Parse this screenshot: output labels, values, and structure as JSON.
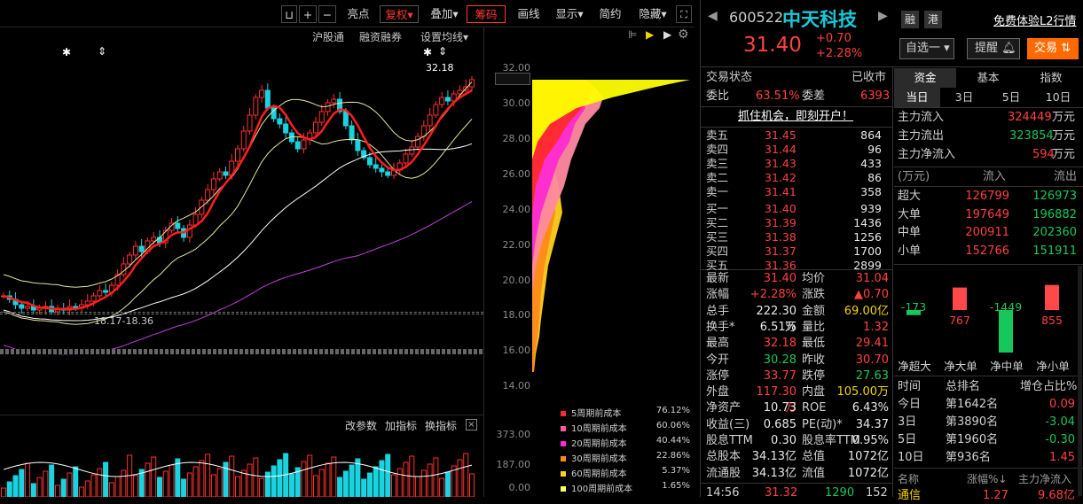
{
  "toolbar": {
    "items": [
      "亮点",
      "复权",
      "叠加",
      "筹码",
      "画线",
      "显示",
      "简约",
      "隐藏"
    ],
    "fq_label": "复权",
    "overlay_label": "叠加",
    "chip_label": "筹码"
  },
  "subbar": {
    "hgt": "沪股通",
    "rzrq": "融资融券",
    "ma": "设置均线"
  },
  "chart": {
    "high_label": "32.18",
    "range_label": "18.17-18.36",
    "price_ticks": [
      "32.00",
      "31.08",
      "30.00",
      "28.00",
      "26.00",
      "24.00",
      "22.00",
      "20.00",
      "18.00",
      "16.00",
      "14.00"
    ],
    "vol_ticks": [
      "373.00",
      "187.00",
      "0.00"
    ],
    "indicators": {
      "params": "改参数",
      "add": "加指标",
      "swap": "换指标"
    }
  },
  "chip_legend": [
    {
      "label": "5周期前成本",
      "pct": "76.12%",
      "color": "#ff2a2a"
    },
    {
      "label": "10周期前成本",
      "pct": "60.06%",
      "color": "#ff5aa0"
    },
    {
      "label": "20周期前成本",
      "pct": "40.44%",
      "color": "#ff2ad0"
    },
    {
      "label": "30周期前成本",
      "pct": "22.86%",
      "color": "#ff8a1a"
    },
    {
      "label": "60周期前成本",
      "pct": "5.37%",
      "color": "#ffd21a"
    },
    {
      "label": "100周期前成本",
      "pct": "1.65%",
      "color": "#ffff66"
    }
  ],
  "stock": {
    "code": "600522",
    "name": "中天科技",
    "price": "31.40",
    "change": "+0.70",
    "change_pct": "+2.28%",
    "tag_rong": "融",
    "tag_gang": "港",
    "l2": "免费体验L2行情",
    "self_select": "自选一",
    "alert": "提醒",
    "trade": "交易",
    "status_label": "交易状态",
    "status": "已收市",
    "weibi_label": "委比",
    "weibi": "63.51%",
    "weicha_label": "委差",
    "weicha": "6393",
    "promo": "抓住机会，即刻开户！"
  },
  "orderbook": {
    "sell": [
      [
        "卖五",
        "31.45",
        "864"
      ],
      [
        "卖四",
        "31.44",
        "96"
      ],
      [
        "卖三",
        "31.43",
        "433"
      ],
      [
        "卖二",
        "31.42",
        "86"
      ],
      [
        "卖一",
        "31.41",
        "358"
      ]
    ],
    "buy": [
      [
        "买一",
        "31.40",
        "939"
      ],
      [
        "买二",
        "31.39",
        "1436"
      ],
      [
        "买三",
        "31.38",
        "1256"
      ],
      [
        "买四",
        "31.37",
        "1700"
      ],
      [
        "买五",
        "31.36",
        "2899"
      ]
    ]
  },
  "quote": [
    [
      "最新",
      "31.40",
      "均价",
      "31.04"
    ],
    [
      "涨幅",
      "+2.28%",
      "涨跌",
      "▲0.70"
    ],
    [
      "总手",
      "222.30万",
      "金额",
      "69.00亿"
    ],
    [
      "换手*",
      "6.51%",
      "量比",
      "1.32"
    ],
    [
      "最高",
      "32.18",
      "最低",
      "29.41"
    ],
    [
      "今开",
      "30.28",
      "昨收",
      "30.70"
    ],
    [
      "涨停",
      "33.77",
      "跌停",
      "27.63"
    ],
    [
      "外盘",
      "117.30万",
      "内盘",
      "105.00万"
    ],
    [
      "净资产",
      "10.73",
      "ROE",
      "6.43%"
    ],
    [
      "收益(三)",
      "0.685",
      "PE(动)*",
      "34.37"
    ],
    [
      "股息TTM",
      "0.30",
      "股息率TTM",
      "0.95%"
    ],
    [
      "总股本",
      "34.13亿",
      "总值",
      "1072亿"
    ],
    [
      "流通股",
      "34.13亿",
      "流值",
      "1072亿"
    ]
  ],
  "tick": [
    "14:56",
    "31.32",
    "1290",
    "152"
  ],
  "fund": {
    "tabs": [
      "资金",
      "基本",
      "指数"
    ],
    "periods": [
      "当日",
      "3日",
      "5日",
      "10日"
    ],
    "inflow_label": "主力流入",
    "inflow": "324449",
    "outflow_label": "主力流出",
    "outflow": "323854",
    "net_label": "主力净流入",
    "net": "594",
    "unit": "万元",
    "col_unit": "(万元)",
    "col_in": "流入",
    "col_out": "流出",
    "rows": [
      [
        "超大",
        "126799",
        "126973"
      ],
      [
        "大单",
        "197649",
        "196882"
      ],
      [
        "中单",
        "200911",
        "202360"
      ],
      [
        "小单",
        "152766",
        "151911"
      ]
    ],
    "bars": [
      {
        "label": "净超大",
        "value": "-173",
        "num": -173
      },
      {
        "label": "净大单",
        "value": "767",
        "num": 767
      },
      {
        "label": "净中单",
        "value": "-1449",
        "num": -1449
      },
      {
        "label": "净小单",
        "value": "855",
        "num": 855
      }
    ],
    "rank_headers": [
      "时间",
      "总排名",
      "增仓占比%"
    ],
    "ranks": [
      [
        "今日",
        "第1642名",
        "0.09"
      ],
      [
        "3日",
        "第3890名",
        "-3.04"
      ],
      [
        "5日",
        "第1960名",
        "-0.30"
      ],
      [
        "10日",
        "第936名",
        "1.45"
      ]
    ],
    "sector_headers": [
      "名称",
      "涨幅%↓",
      "主力净流入"
    ],
    "sector_row": [
      "通信",
      "1.27",
      "9.68亿"
    ]
  }
}
